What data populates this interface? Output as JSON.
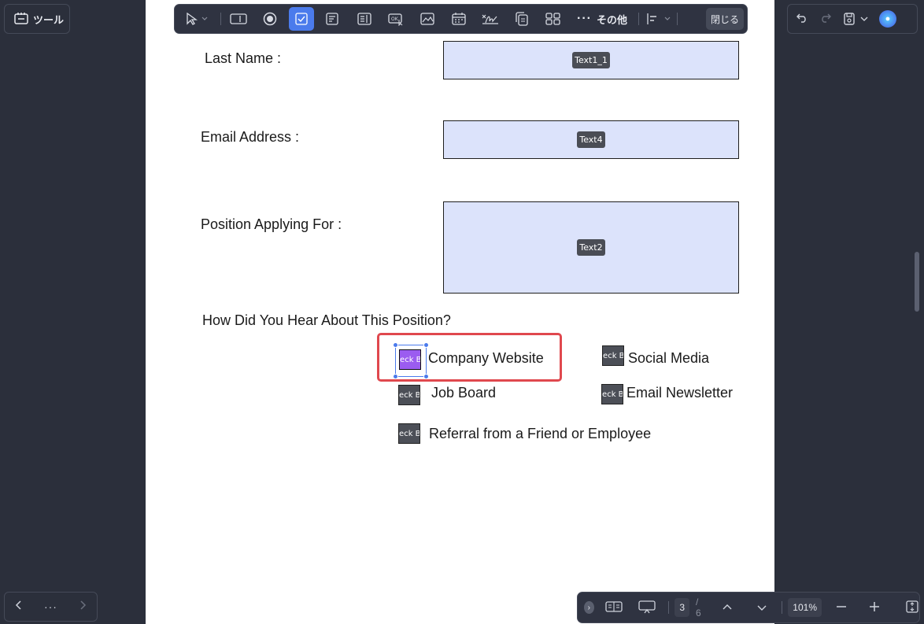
{
  "top_left": {
    "tools_label": "ツール"
  },
  "toolbar": {
    "more_label": "その他",
    "close_label": "閉じる"
  },
  "form": {
    "last_name_label": "Last Name :",
    "last_name_field": "Text1_1",
    "email_label": "Email Address :",
    "email_field": "Text4",
    "position_label": "Position Applying For :",
    "position_field": "Text2",
    "hear_question": "How Did You Hear About This Position?",
    "checkbox_tag": "Check Box",
    "options": [
      "Company Website",
      "Social Media",
      "Job Board",
      "Email Newsletter",
      "Referral from a Friend or Employee"
    ]
  },
  "bottom_bar": {
    "page_current": "3",
    "page_total": "/ 6",
    "zoom": "101%"
  },
  "bottom_nav": {
    "more": "···"
  }
}
